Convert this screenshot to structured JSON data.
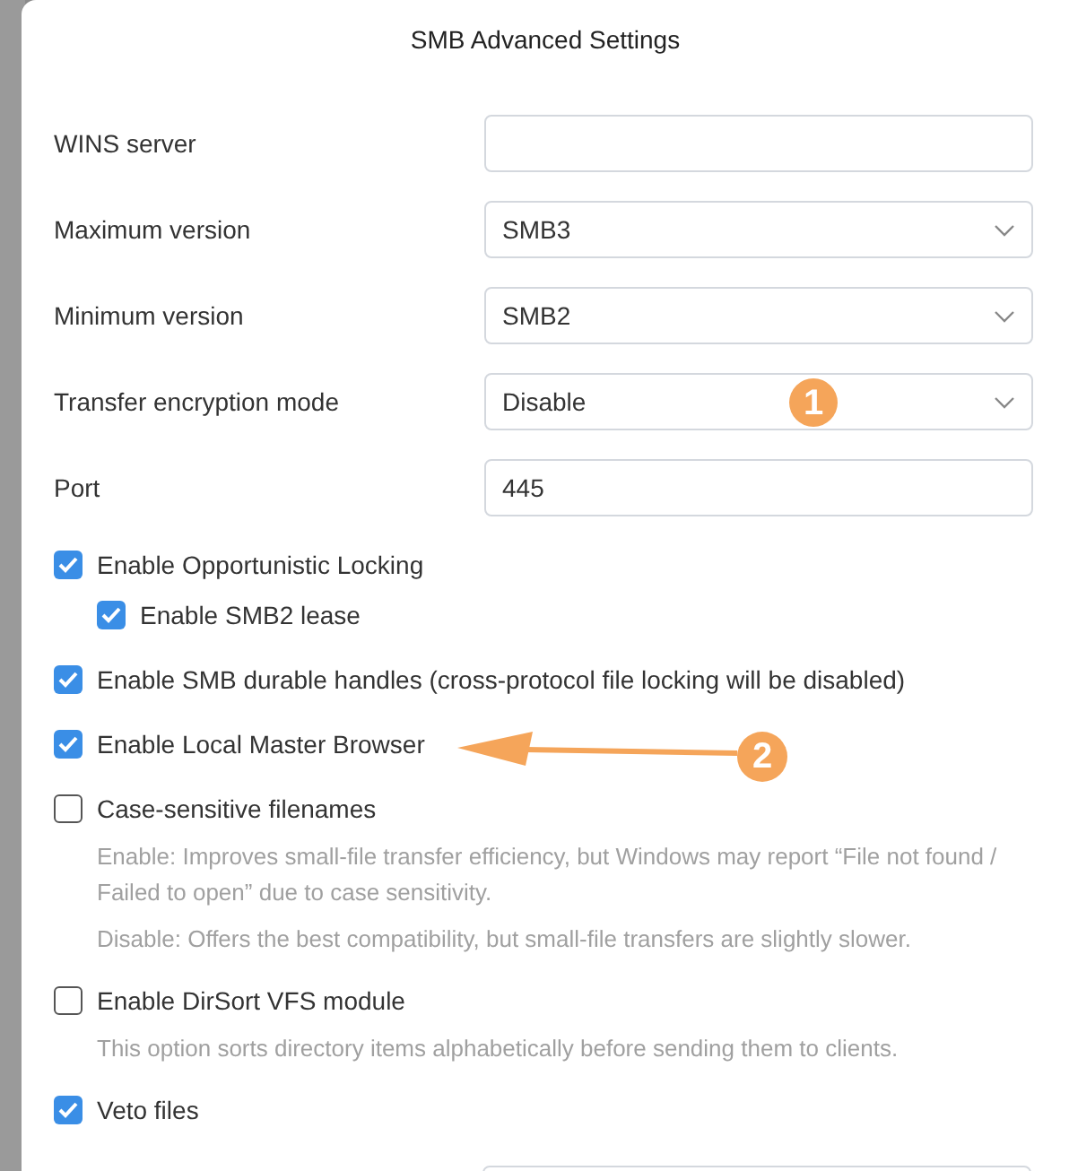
{
  "dialog": {
    "title": "SMB Advanced Settings"
  },
  "fields": [
    {
      "label": "WINS server",
      "kind": "text"
    },
    {
      "label": "Maximum version",
      "kind": "select",
      "value": "SMB3"
    },
    {
      "label": "Minimum version",
      "kind": "select",
      "value": "SMB2"
    },
    {
      "label": "Transfer encryption mode",
      "kind": "select",
      "value": "Disable"
    },
    {
      "label": "Port",
      "kind": "text",
      "value": "445"
    }
  ],
  "options": [
    {
      "label": "Enable Opportunistic Locking",
      "checked": true,
      "children": [
        {
          "label": "Enable SMB2 lease",
          "checked": true
        }
      ]
    },
    {
      "label": "Enable SMB durable handles (cross-protocol file locking will be disabled)",
      "checked": true
    },
    {
      "label": "Enable Local Master Browser",
      "checked": true
    },
    {
      "label": "Case-sensitive filenames",
      "checked": false,
      "descriptions": [
        "Enable: Improves small-file transfer efficiency, but Windows may report “File not found / Failed to open” due to case sensitivity.",
        "Disable: Offers the best compatibility, but small-file transfers are slightly slower."
      ]
    },
    {
      "label": "Enable DirSort VFS module",
      "checked": false,
      "descriptions": [
        "This option sorts directory items alphabetically before sending them to clients."
      ]
    },
    {
      "label": "Veto files",
      "checked": true
    }
  ],
  "annotations": [
    {
      "text": "1",
      "kind": "badge"
    },
    {
      "text": "2",
      "kind": "arrow"
    }
  ]
}
